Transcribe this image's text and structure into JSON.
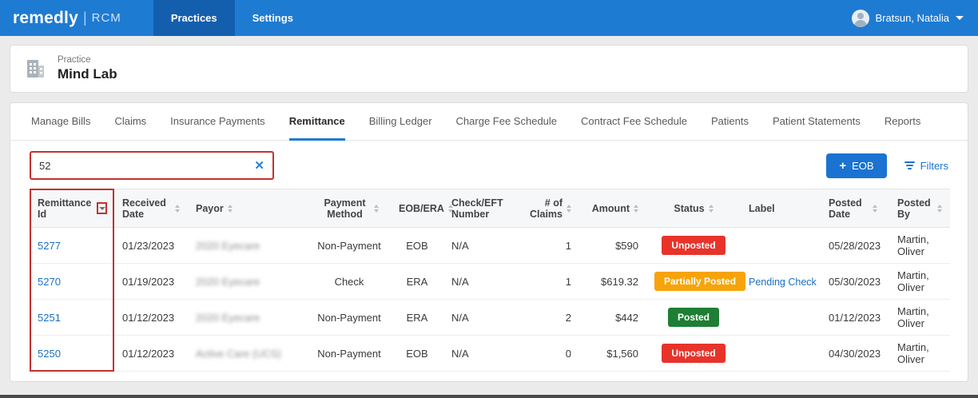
{
  "header": {
    "brand": "remedly",
    "brand_product": "RCM",
    "nav": [
      {
        "label": "Practices",
        "active": true
      },
      {
        "label": "Settings",
        "active": false
      }
    ],
    "user_name": "Bratsun, Natalia"
  },
  "practice": {
    "label": "Practice",
    "name": "Mind Lab"
  },
  "tabs": [
    {
      "label": "Manage Bills",
      "active": false
    },
    {
      "label": "Claims",
      "active": false
    },
    {
      "label": "Insurance Payments",
      "active": false
    },
    {
      "label": "Remittance",
      "active": true
    },
    {
      "label": "Billing Ledger",
      "active": false
    },
    {
      "label": "Charge Fee Schedule",
      "active": false
    },
    {
      "label": "Contract Fee Schedule",
      "active": false
    },
    {
      "label": "Patients",
      "active": false
    },
    {
      "label": "Patient Statements",
      "active": false
    },
    {
      "label": "Reports",
      "active": false
    }
  ],
  "toolbar": {
    "search_value": "52",
    "clear_icon": "✕",
    "eob_plus": "+",
    "eob_button": "EOB",
    "filters_label": "Filters"
  },
  "table": {
    "columns": [
      "Remittance Id",
      "Received Date",
      "Payor",
      "Payment Method",
      "EOB/ERA",
      "Check/EFT Number",
      "# of Claims",
      "Amount",
      "Status",
      "Label",
      "Posted Date",
      "Posted By"
    ],
    "rows": [
      {
        "id": "5277",
        "received_date": "01/23/2023",
        "payor": "2020 Eyecare",
        "payment_method": "Non-Payment",
        "eob_era": "EOB",
        "check_eft": "N/A",
        "claims": "1",
        "amount": "$590",
        "status": "Unposted",
        "status_class": "unposted",
        "label": "",
        "posted_date": "05/28/2023",
        "posted_by": "Martin, Oliver"
      },
      {
        "id": "5270",
        "received_date": "01/19/2023",
        "payor": "2020 Eyecare",
        "payment_method": "Check",
        "eob_era": "ERA",
        "check_eft": "N/A",
        "claims": "1",
        "amount": "$619.32",
        "status": "Partially Posted",
        "status_class": "partially-posted",
        "label": "Pending Check",
        "posted_date": "05/30/2023",
        "posted_by": "Martin, Oliver"
      },
      {
        "id": "5251",
        "received_date": "01/12/2023",
        "payor": "2020 Eyecare",
        "payment_method": "Non-Payment",
        "eob_era": "ERA",
        "check_eft": "N/A",
        "claims": "2",
        "amount": "$442",
        "status": "Posted",
        "status_class": "posted",
        "label": "",
        "posted_date": "01/12/2023",
        "posted_by": "Martin, Oliver"
      },
      {
        "id": "5250",
        "received_date": "01/12/2023",
        "payor": "Active Care (UCS)",
        "payment_method": "Non-Payment",
        "eob_era": "EOB",
        "check_eft": "N/A",
        "claims": "0",
        "amount": "$1,560",
        "status": "Unposted",
        "status_class": "unposted",
        "label": "",
        "posted_date": "04/30/2023",
        "posted_by": "Martin, Oliver"
      }
    ]
  },
  "colors": {
    "header_blue": "#1e7bd2",
    "active_nav_blue": "#135fae",
    "accent_blue": "#1a73d1",
    "status_unposted_red": "#e8332a",
    "status_partially_posted_orange": "#f7a30a",
    "status_posted_green": "#1e7e34",
    "annotation_red": "#c43131"
  }
}
